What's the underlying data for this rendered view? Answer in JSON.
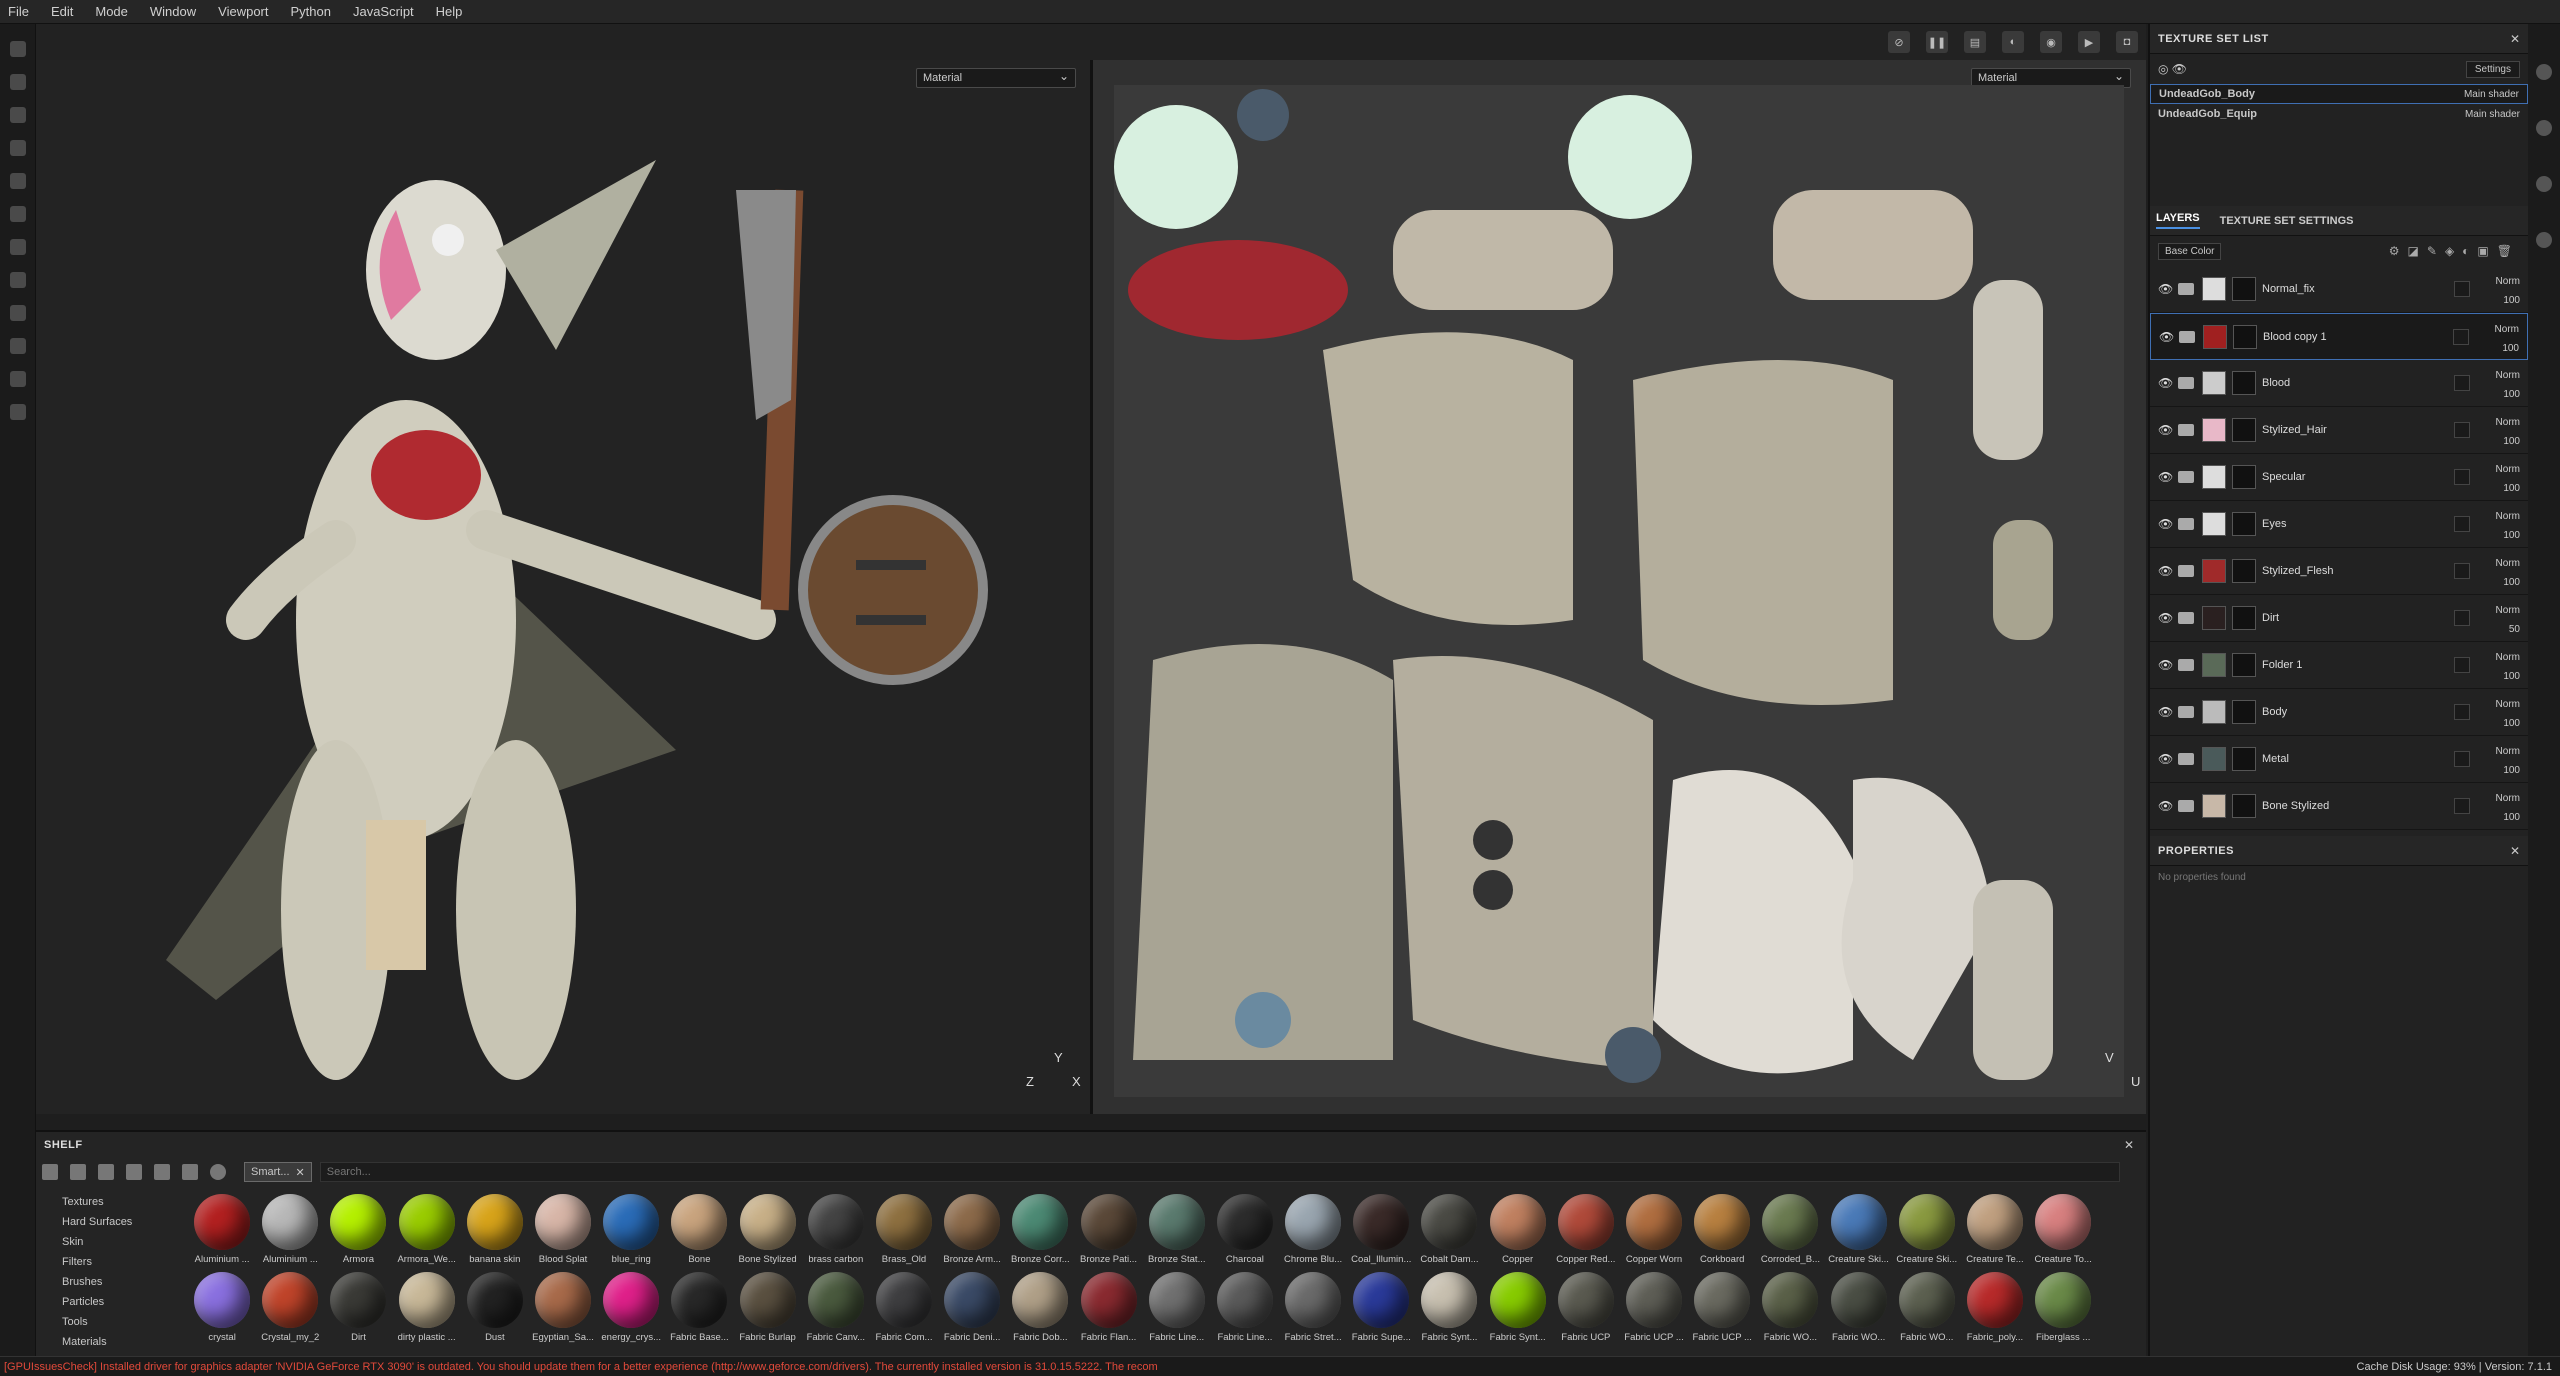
{
  "menu": [
    "File",
    "Edit",
    "Mode",
    "Window",
    "Viewport",
    "Python",
    "JavaScript",
    "Help"
  ],
  "viewport": {
    "left_select": "Material",
    "right_select": "Material",
    "axis3d_y": "Y",
    "axis3d_z": "Z",
    "axis3d_x": "X",
    "axis2d_v": "V",
    "axis2d_u": "U"
  },
  "shelf": {
    "title": "SHELF",
    "tag": "Smart...",
    "search_placeholder": "Search...",
    "categories": [
      "Textures",
      "Hard Surfaces",
      "Skin",
      "Filters",
      "Brushes",
      "Particles",
      "Tools",
      "Materials"
    ],
    "materials": [
      {
        "label": "Aluminium ...",
        "color": "#b32020"
      },
      {
        "label": "Aluminium ...",
        "color": "#b8b8b8"
      },
      {
        "label": "Armora",
        "color": "#b5f000"
      },
      {
        "label": "Armora_We...",
        "color": "#9acd00"
      },
      {
        "label": "banana skin",
        "color": "#d8a41a"
      },
      {
        "label": "Blood Splat",
        "color": "#d8b6a8"
      },
      {
        "label": "blue_ring",
        "color": "#2a6cb8"
      },
      {
        "label": "Bone",
        "color": "#c9a47e"
      },
      {
        "label": "Bone Stylized",
        "color": "#c8b088"
      },
      {
        "label": "brass carbon",
        "color": "#444"
      },
      {
        "label": "Brass_Old",
        "color": "#8e7040"
      },
      {
        "label": "Bronze Arm...",
        "color": "#8c6a4a"
      },
      {
        "label": "Bronze Corr...",
        "color": "#4c8a74"
      },
      {
        "label": "Bronze Pati...",
        "color": "#5a4838"
      },
      {
        "label": "Bronze Stat...",
        "color": "#5a7a6e"
      },
      {
        "label": "Charcoal",
        "color": "#2c2c2c"
      },
      {
        "label": "Chrome Blu...",
        "color": "#9aa6b0"
      },
      {
        "label": "Coal_Illumin...",
        "color": "#3a2a28"
      },
      {
        "label": "Cobalt Dam...",
        "color": "#4a4a44"
      },
      {
        "label": "Copper",
        "color": "#c08060"
      },
      {
        "label": "Copper Red...",
        "color": "#b04a3a"
      },
      {
        "label": "Copper Worn",
        "color": "#b06e40"
      },
      {
        "label": "Corkboard",
        "color": "#b88040"
      },
      {
        "label": "Corroded_B...",
        "color": "#6a7a50"
      },
      {
        "label": "Creature Ski...",
        "color": "#4a7ab8"
      },
      {
        "label": "Creature Ski...",
        "color": "#8a9a40"
      },
      {
        "label": "Creature Te...",
        "color": "#c0a080"
      },
      {
        "label": "Creature To...",
        "color": "#d88080"
      },
      {
        "label": "crystal",
        "color": "#8a70e0"
      },
      {
        "label": "Crystal_my_2",
        "color": "#c0442a"
      },
      {
        "label": "Dirt",
        "color": "#3a3a36"
      },
      {
        "label": "dirty plastic ...",
        "color": "#c8b898"
      },
      {
        "label": "Dust",
        "color": "#222"
      },
      {
        "label": "Egyptian_Sa...",
        "color": "#a86a4a"
      },
      {
        "label": "energy_crys...",
        "color": "#e0208a"
      },
      {
        "label": "Fabric Base...",
        "color": "#282828"
      },
      {
        "label": "Fabric Burlap",
        "color": "#5a5040"
      },
      {
        "label": "Fabric Canv...",
        "color": "#4a5a3e"
      },
      {
        "label": "Fabric Com...",
        "color": "#3e3e40"
      },
      {
        "label": "Fabric Deni...",
        "color": "#3a4a66"
      },
      {
        "label": "Fabric Dob...",
        "color": "#b0a088"
      },
      {
        "label": "Fabric Flan...",
        "color": "#8a2a30"
      },
      {
        "label": "Fabric Line...",
        "color": "#707070"
      },
      {
        "label": "Fabric Line...",
        "color": "#5a5a5a"
      },
      {
        "label": "Fabric Stret...",
        "color": "#6a6a6a"
      },
      {
        "label": "Fabric Supe...",
        "color": "#2a3a9a"
      },
      {
        "label": "Fabric Synt...",
        "color": "#c8c0b0"
      },
      {
        "label": "Fabric Synt...",
        "color": "#88cc00"
      },
      {
        "label": "Fabric UCP",
        "color": "#5a5a50"
      },
      {
        "label": "Fabric UCP ...",
        "color": "#5e5e56"
      },
      {
        "label": "Fabric UCP ...",
        "color": "#6a6a60"
      },
      {
        "label": "Fabric WO...",
        "color": "#5a6048"
      },
      {
        "label": "Fabric WO...",
        "color": "#4a4e44"
      },
      {
        "label": "Fabric WO...",
        "color": "#5c6050"
      },
      {
        "label": "Fabric_poly...",
        "color": "#b82a2a"
      },
      {
        "label": "Fiberglass ...",
        "color": "#6a8a48"
      }
    ]
  },
  "texture_set_list": {
    "title": "TEXTURE SET LIST",
    "settings": "Settings",
    "sets": [
      {
        "name": "UndeadGob_Body",
        "shader": "Main shader"
      },
      {
        "name": "UndeadGob_Equip",
        "shader": "Main shader"
      }
    ]
  },
  "layers_panel": {
    "tab_layers": "LAYERS",
    "tab_settings": "TEXTURE SET SETTINGS",
    "channel": "Base Color",
    "layers": [
      {
        "name": "Normal_fix",
        "blend": "Norm",
        "opacity": "100",
        "thumb": "#ddd"
      },
      {
        "name": "Blood copy 1",
        "blend": "Norm",
        "opacity": "100",
        "thumb": "#a02020"
      },
      {
        "name": "Blood",
        "blend": "Norm",
        "opacity": "100",
        "thumb": "#ccc"
      },
      {
        "name": "Stylized_Hair",
        "blend": "Norm",
        "opacity": "100",
        "thumb": "#e8b8c8"
      },
      {
        "name": "Specular",
        "blend": "Norm",
        "opacity": "100",
        "thumb": "#ddd"
      },
      {
        "name": "Eyes",
        "blend": "Norm",
        "opacity": "100",
        "thumb": "#ddd"
      },
      {
        "name": "Stylized_Flesh",
        "blend": "Norm",
        "opacity": "100",
        "thumb": "#a02a2a"
      },
      {
        "name": "Dirt",
        "blend": "Norm",
        "opacity": "50",
        "thumb": "#2a2020"
      },
      {
        "name": "Folder 1",
        "blend": "Norm",
        "opacity": "100",
        "thumb": "#5a6a58"
      },
      {
        "name": "Body",
        "blend": "Norm",
        "opacity": "100",
        "thumb": "#bbb"
      },
      {
        "name": "Metal",
        "blend": "Norm",
        "opacity": "100",
        "thumb": "#4a5a5a"
      },
      {
        "name": "Bone Stylized",
        "blend": "Norm",
        "opacity": "100",
        "thumb": "#c8b8a8"
      }
    ]
  },
  "properties": {
    "title": "PROPERTIES",
    "empty": "No properties found"
  },
  "status": {
    "message": "[GPUIssuesCheck] Installed driver for graphics adapter 'NVIDIA GeForce RTX 3090' is outdated. You should update them for a better experience (http://www.geforce.com/drivers). The currently installed version is 31.0.15.5222. The recom",
    "right": "Cache Disk Usage:   93% | Version: 7.1.1"
  }
}
